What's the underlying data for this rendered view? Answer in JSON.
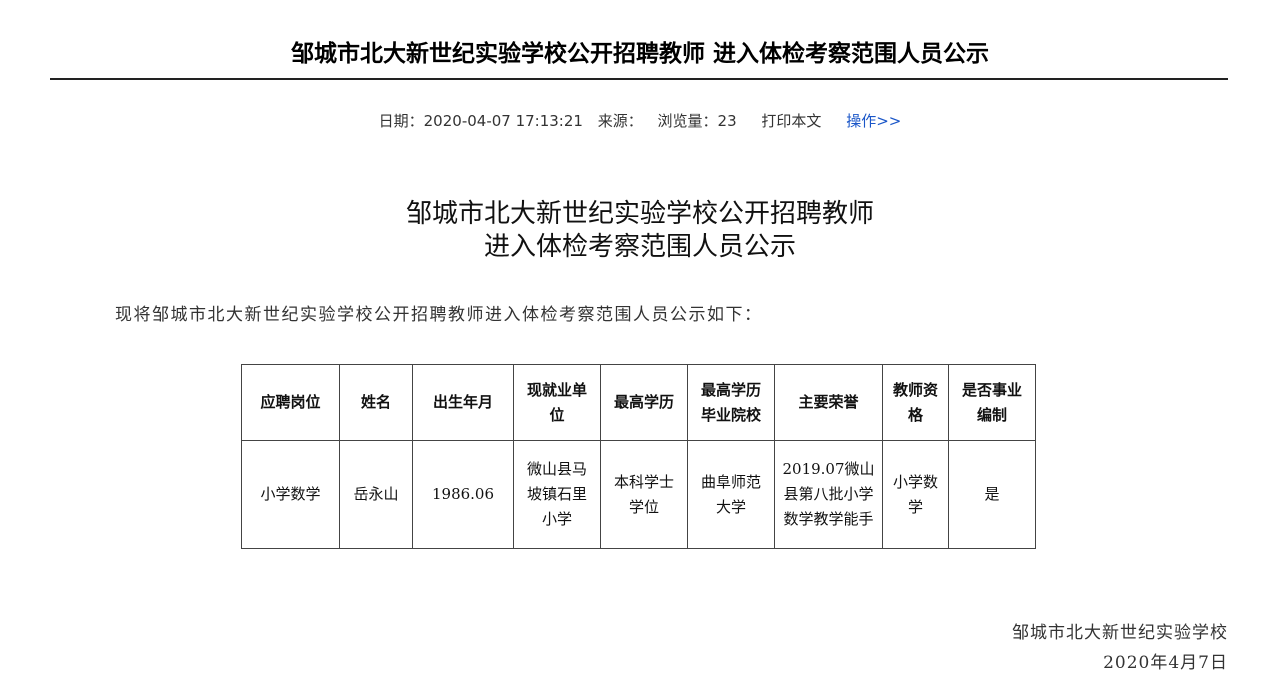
{
  "page_title": "邹城市北大新世纪实验学校公开招聘教师 进入体检考察范围人员公示",
  "meta": {
    "date_label": "日期：",
    "date_value": "2020-04-07 17:13:21",
    "source_label": "来源：",
    "source_value": "",
    "views_label": "浏览量：",
    "views_value": "23",
    "print_label": "打印本文",
    "operation_label": "操作>>"
  },
  "doc_title": {
    "line1": "邹城市北大新世纪实验学校公开招聘教师",
    "line2": "进入体检考察范围人员公示"
  },
  "intro": "现将邹城市北大新世纪实验学校公开招聘教师进入体检考察范围人员公示如下：",
  "table": {
    "headers": [
      "应聘岗位",
      "姓名",
      "出生年月",
      "现就业单位",
      "最高学历",
      "最高学历毕业院校",
      "主要荣誉",
      "教师资格",
      "是否事业编制"
    ],
    "rows": [
      [
        "小学数学",
        "岳永山",
        "1986.06",
        "微山县马坡镇石里小学",
        "本科学士学位",
        "曲阜师范大学",
        "2019.07微山县第八批小学数学教学能手",
        "小学数学",
        "是"
      ]
    ]
  },
  "signature": {
    "org": "邹城市北大新世纪实验学校",
    "date": "2020年4月7日"
  }
}
